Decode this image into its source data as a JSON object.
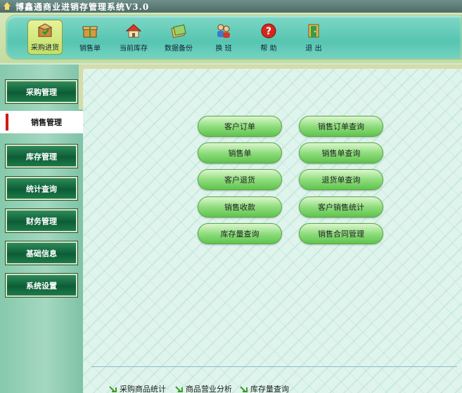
{
  "window": {
    "title": "博鑫通商业进销存管理系统V3.0"
  },
  "toolbar": {
    "buttons": [
      {
        "label": "采购进货",
        "icon": "box-icon",
        "active": true
      },
      {
        "label": "销售单",
        "icon": "gift-box-icon",
        "active": false
      },
      {
        "label": "当前库存",
        "icon": "house-icon",
        "active": false
      },
      {
        "label": "数据备份",
        "icon": "backup-icon",
        "active": false
      },
      {
        "label": "换 班",
        "icon": "users-icon",
        "active": false
      },
      {
        "label": "帮 助",
        "icon": "help-icon",
        "active": false
      },
      {
        "label": "退 出",
        "icon": "exit-door-icon",
        "active": false
      }
    ]
  },
  "sidebar": {
    "items": [
      {
        "label": "采购管理"
      },
      {
        "label": "销售管理",
        "active": true
      },
      {
        "label": "库存管理"
      },
      {
        "label": "统计查询"
      },
      {
        "label": "财务管理"
      },
      {
        "label": "基础信息"
      },
      {
        "label": "系统设置"
      }
    ]
  },
  "main": {
    "left_buttons": [
      "客户订单",
      "销售单",
      "客户退货",
      "销售收款",
      "库存量查询"
    ],
    "right_buttons": [
      "销售订单查询",
      "销售单查询",
      "退货单查询",
      "客户销售统计",
      "销售合同管理"
    ],
    "quick_links": [
      "采购商品统计",
      "商品营业分析",
      "库存量查询"
    ]
  },
  "colors": {
    "toolbar": "#56c5b1",
    "sidebar_button": "#0c5d36",
    "action_button": "#8fdd7d",
    "active_marker": "#d41818"
  }
}
